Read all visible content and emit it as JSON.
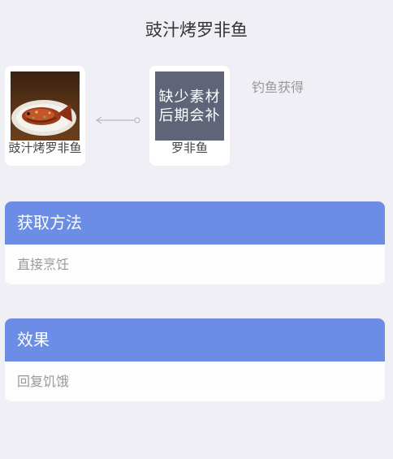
{
  "page": {
    "title": "豉汁烤罗非鱼"
  },
  "recipe": {
    "product": {
      "label": "豉汁烤罗非鱼",
      "icon": "grilled-fish-dish-icon"
    },
    "ingredient": {
      "label": "罗非鱼",
      "placeholder_line1": "缺少素材",
      "placeholder_line2": "后期会补"
    },
    "source_text": "钓鱼获得"
  },
  "sections": {
    "obtain": {
      "title": "获取方法",
      "value": "直接烹饪"
    },
    "effect": {
      "title": "效果",
      "value": "回复饥饿"
    }
  },
  "colors": {
    "background": "#f0eff5",
    "header_blue": "#6b8de6",
    "card": "#ffffff",
    "muted_text": "#999999"
  }
}
